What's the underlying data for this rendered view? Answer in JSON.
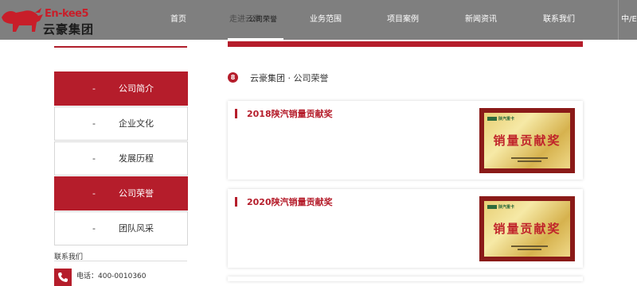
{
  "brand": {
    "logo_en": "En-kee5",
    "logo_cn": "云豪集团"
  },
  "nav": {
    "items": [
      {
        "label": "首页"
      },
      {
        "label": "走进云豪"
      },
      {
        "label": "业务范围"
      },
      {
        "label": "项目案例"
      },
      {
        "label": "新闻资讯"
      },
      {
        "label": "联系我们"
      }
    ],
    "active_overlay_label": "公司荣誉",
    "lang": "中/E"
  },
  "sidebar": {
    "items": [
      {
        "dash": "-",
        "label": "公司简介",
        "active": true
      },
      {
        "dash": "-",
        "label": "企业文化",
        "active": false
      },
      {
        "dash": "-",
        "label": "发展历程",
        "active": false
      },
      {
        "dash": "-",
        "label": "公司荣誉",
        "active": true
      },
      {
        "dash": "-",
        "label": "团队风采",
        "active": false
      }
    ],
    "contact_title": "联系我们",
    "phone": "电话：400-0010360"
  },
  "breadcrumb": {
    "text": "云豪集团 · 公司荣誉",
    "icon": "8"
  },
  "honors": [
    {
      "title": "2018陕汽销量贡献奖",
      "plaque_brand": "陕汽重卡",
      "plaque_text": "销量贡献奖"
    },
    {
      "title": "2020陕汽销量贡献奖",
      "plaque_brand": "陕汽重卡",
      "plaque_text": "销量贡献奖"
    }
  ],
  "colors": {
    "accent": "#b51d2b",
    "nav_bg": "#7f7f7f"
  }
}
